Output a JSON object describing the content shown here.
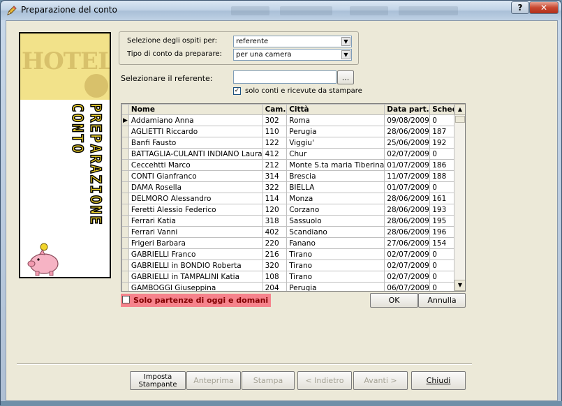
{
  "window": {
    "title": "Preparazione del conto",
    "help_label": "?",
    "close_label": "✕"
  },
  "banner": {
    "hotel_text": "HOTEL",
    "vertical_line1": "PREPARAZIONE",
    "vertical_line2": "CONTO"
  },
  "filters": {
    "guest_select_label": "Selezione degli ospiti per:",
    "guest_select_value": "referente",
    "bill_type_label": "Tipo di conto da preparare:",
    "bill_type_value": "per una camera",
    "referent_label": "Selezionare il referente:",
    "referent_value": "",
    "browse_label": "...",
    "only_bills_label": "solo conti e ricevute da stampare",
    "only_bills_checked": true
  },
  "grid": {
    "columns": [
      "Nome",
      "Cam.",
      "Città",
      "Data part.",
      "Scheda"
    ],
    "selected_row": 0,
    "rows": [
      [
        "Addamiano Anna",
        "302",
        "Roma",
        "09/08/2009",
        "0"
      ],
      [
        "AGLIETTI Riccardo",
        "110",
        "Perugia",
        "28/06/2009",
        "187"
      ],
      [
        "Banfi Fausto",
        "122",
        "Viggiu'",
        "25/06/2009",
        "192"
      ],
      [
        "BATTAGLIA-CULANTI INDIANO Laura",
        "412",
        "Chur",
        "02/07/2009",
        "0"
      ],
      [
        "Ceccehtti Marco",
        "212",
        "Monte S.ta maria Tiberina",
        "01/07/2009",
        "186"
      ],
      [
        "CONTI Gianfranco",
        "314",
        "Brescia",
        "11/07/2009",
        "188"
      ],
      [
        "DAMA Rosella",
        "322",
        "BIELLA",
        "01/07/2009",
        "0"
      ],
      [
        "DELMORO Alessandro",
        "114",
        "Monza",
        "28/06/2009",
        "161"
      ],
      [
        "Feretti Alessio Federico",
        "120",
        "Corzano",
        "28/06/2009",
        "193"
      ],
      [
        "Ferrari Katia",
        "318",
        "Sassuolo",
        "28/06/2009",
        "195"
      ],
      [
        "Ferrari Vanni",
        "402",
        "Scandiano",
        "28/06/2009",
        "196"
      ],
      [
        "Frigeri Barbara",
        "220",
        "Fanano",
        "27/06/2009",
        "154"
      ],
      [
        "GABRIELLI Franco",
        "216",
        "Tirano",
        "02/07/2009",
        "0"
      ],
      [
        "GABRIELLI in BONDIO Roberta",
        "320",
        "Tirano",
        "02/07/2009",
        "0"
      ],
      [
        "GABRIELLI in TAMPALINI Katia",
        "108",
        "Tirano",
        "02/07/2009",
        "0"
      ],
      [
        "GAMBOGGI Giuseppina",
        "204",
        "Perugia",
        "06/07/2009",
        "0"
      ]
    ]
  },
  "today_tomorrow": {
    "label": "Solo partenze di oggi e domani",
    "checked": false
  },
  "dialog_buttons": {
    "ok": "OK",
    "cancel": "Annulla"
  },
  "footer": {
    "printer_setup_line1": "Imposta",
    "printer_setup_line2": "Stampante",
    "preview": "Anteprima",
    "print": "Stampa",
    "back": "< Indietro",
    "next": "Avanti >",
    "close": "Chiudi"
  }
}
